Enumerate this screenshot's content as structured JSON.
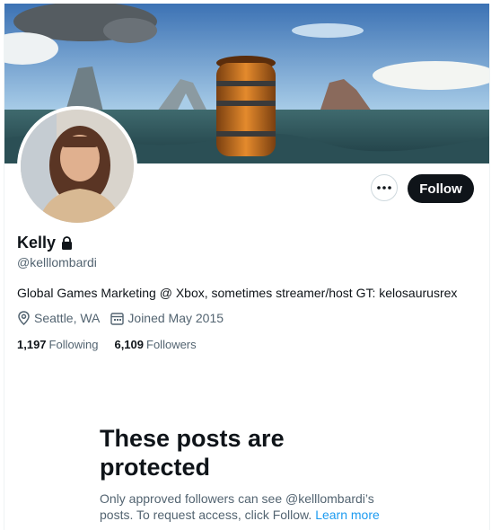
{
  "profile": {
    "name": "Kelly",
    "handle": "@kelllombardi",
    "bio": "Global Games Marketing @ Xbox, sometimes streamer/host GT: kelosaurusrex",
    "location": "Seattle, WA",
    "joined": "Joined May 2015",
    "following_count": "1,197",
    "following_label": "Following",
    "followers_count": "6,109",
    "followers_label": "Followers",
    "locked": true
  },
  "actions": {
    "follow_label": "Follow",
    "more_icon": "more-horizontal-icon"
  },
  "protected": {
    "title_line1": "These posts are",
    "title_line2": "protected",
    "body": "Only approved followers can see @kelllombardi’s posts. To request access, click Follow.",
    "link": "Learn more"
  },
  "icons": {
    "lock": "lock-icon",
    "location": "location-pin-icon",
    "calendar": "calendar-icon"
  },
  "colors": {
    "accent": "#1d9bf0",
    "follow_bg": "#0f1419",
    "secondary_text": "#536471"
  }
}
